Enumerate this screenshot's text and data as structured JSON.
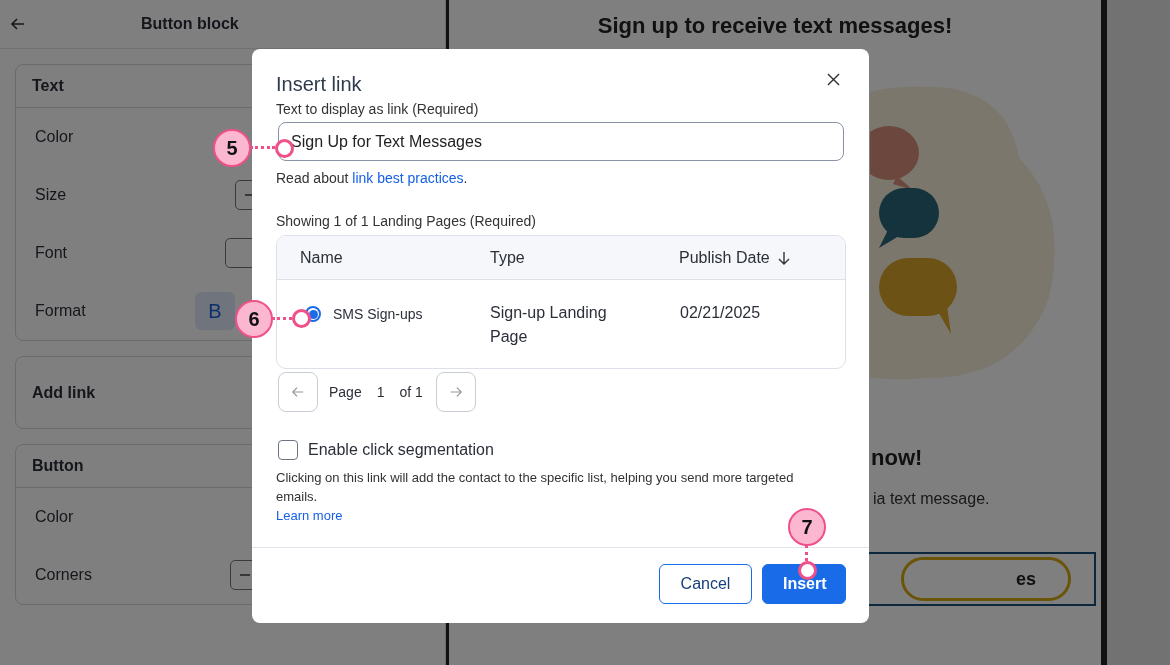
{
  "editor_panel": {
    "title": "Button block",
    "sections": [
      {
        "kind": "rows",
        "title": "Text",
        "rows": [
          {
            "kind": "label",
            "label": "Color"
          },
          {
            "kind": "stepper",
            "label": "Size"
          },
          {
            "kind": "select",
            "label": "Font"
          },
          {
            "kind": "format",
            "label": "Format",
            "value": "B"
          }
        ]
      },
      {
        "kind": "single",
        "title": "Add link"
      },
      {
        "kind": "rows",
        "title": "Button",
        "rows": [
          {
            "kind": "label",
            "label": "Color"
          },
          {
            "kind": "stepper",
            "label": "Corners"
          }
        ]
      }
    ]
  },
  "preview": {
    "heading": "Sign up to receive text messages!",
    "subheading": "now!",
    "body": "ia text message.",
    "button": "es"
  },
  "dialog": {
    "title": "Insert link",
    "field_label": "Text to display as link  (Required)",
    "field_value": "Sign Up for Text Messages",
    "help_text": "Read about",
    "help_link": "link best practices",
    "help_end": ".",
    "table_caption": "Showing 1 of 1 Landing Pages  (Required)",
    "columns": [
      {
        "label": "Name",
        "sorted": false
      },
      {
        "label": "Type",
        "sorted": false
      },
      {
        "label": "Publish Date",
        "sorted": true
      }
    ],
    "rows": [
      {
        "name": "SMS Sign-ups",
        "type": "Sign-up Landing Page",
        "publish_date": "02/21/2025",
        "selected": true
      }
    ],
    "pagination": {
      "label": "Page",
      "page": "1",
      "of": "of 1"
    },
    "segmentation": {
      "label": "Enable click segmentation",
      "checked": false,
      "description": "Clicking on this link will add the contact to the specific list, helping you send more targeted emails.",
      "link": "Learn more"
    },
    "buttons": [
      {
        "label": "Cancel",
        "kind": "secondary"
      },
      {
        "label": "Insert",
        "kind": "primary"
      }
    ]
  },
  "callouts": [
    {
      "number": "5"
    },
    {
      "number": "6"
    },
    {
      "number": "7"
    }
  ]
}
